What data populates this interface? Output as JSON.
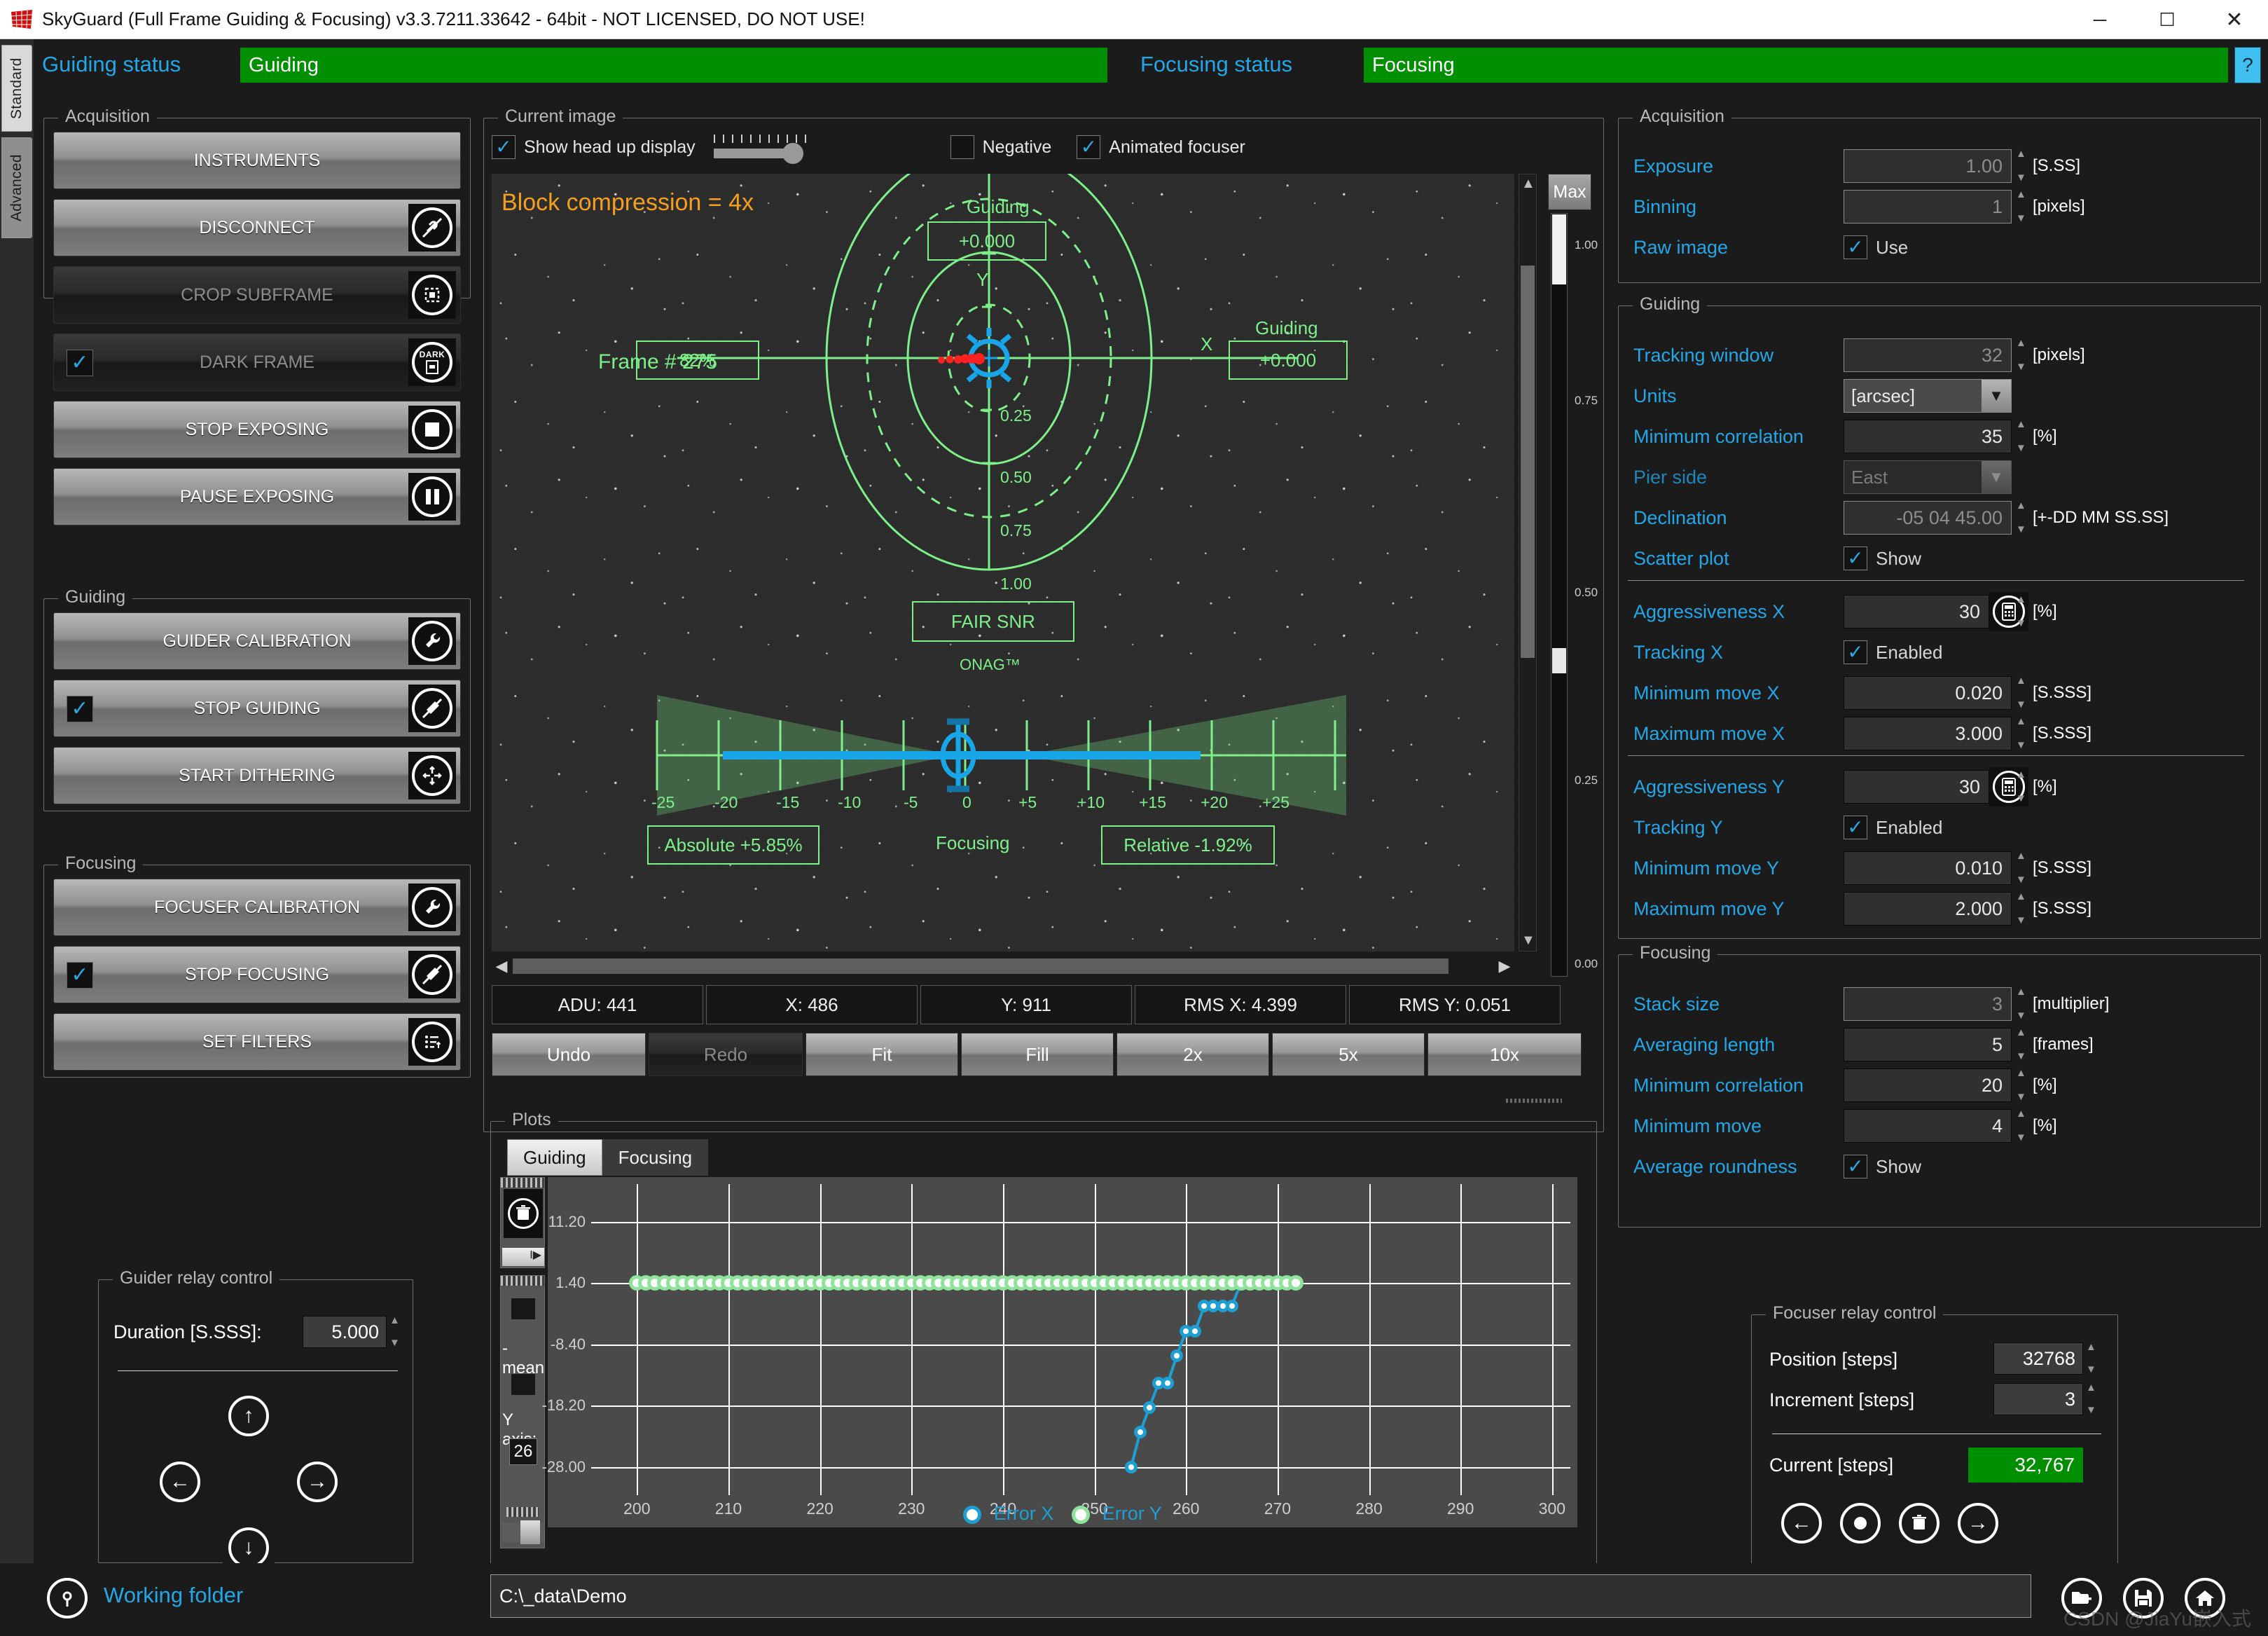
{
  "window": {
    "title": "SkyGuard (Full Frame Guiding & Focusing) v3.3.7211.33642 - 64bit - NOT LICENSED, DO NOT USE!",
    "minimize": "─",
    "maximize": "☐",
    "close": "✕"
  },
  "vtabs": [
    {
      "label": "Standard"
    },
    {
      "label": "Advanced"
    }
  ],
  "status": {
    "guiding_label": "Guiding status",
    "guiding_value": "Guiding",
    "focusing_label": "Focusing status",
    "focusing_value": "Focusing",
    "help": "?",
    "green": "#008f00"
  },
  "left": {
    "acquisition": {
      "title": "Acquisition",
      "buttons": [
        {
          "label": "INSTRUMENTS",
          "icon": "none",
          "checked": null,
          "enabled": true
        },
        {
          "label": "DISCONNECT",
          "icon": "disconnect-plug-icon",
          "checked": null,
          "enabled": true
        },
        {
          "label": "CROP SUBFRAME",
          "icon": "crop-frame-icon",
          "checked": null,
          "enabled": false
        },
        {
          "label": "DARK FRAME",
          "icon": "dark-frame-icon",
          "checked": true,
          "enabled": false
        },
        {
          "label": "STOP EXPOSING",
          "icon": "stop-square-icon",
          "checked": null,
          "enabled": true
        },
        {
          "label": "PAUSE EXPOSING",
          "icon": "pause-icon",
          "checked": null,
          "enabled": true
        }
      ]
    },
    "guiding": {
      "title": "Guiding",
      "buttons": [
        {
          "label": "GUIDER CALIBRATION",
          "icon": "wrench-icon",
          "checked": null,
          "enabled": true
        },
        {
          "label": "STOP GUIDING",
          "icon": "stop-guiding-icon",
          "checked": true,
          "enabled": true
        },
        {
          "label": "START DITHERING",
          "icon": "dither-arrows-icon",
          "checked": null,
          "enabled": true
        }
      ]
    },
    "focusing": {
      "title": "Focusing",
      "buttons": [
        {
          "label": "FOCUSER CALIBRATION",
          "icon": "wrench-icon",
          "checked": null,
          "enabled": true
        },
        {
          "label": "STOP FOCUSING",
          "icon": "stop-focusing-icon",
          "checked": true,
          "enabled": true
        },
        {
          "label": "SET FILTERS",
          "icon": "filter-list-icon",
          "checked": null,
          "enabled": true
        }
      ]
    },
    "guider_relay": {
      "title": "Guider relay control",
      "duration_label": "Duration [S.SSS]:",
      "duration_value": "5.000",
      "up": "↑",
      "down": "↓",
      "left": "←",
      "right": "→"
    }
  },
  "center": {
    "group_title": "Current image",
    "show_hud_label": "Show head up display",
    "show_hud_checked": true,
    "negative_label": "Negative",
    "negative_checked": false,
    "animated_focuser_label": "Animated focuser",
    "animated_focuser_checked": true,
    "hud": {
      "block_compression": "Block compression = 4x",
      "frame": "Frame # 275",
      "guiding_top_label": "Guiding",
      "guiding_top_value": "+0.000",
      "guiding_right_label": "Guiding",
      "guiding_right_value": "+0.000",
      "snr_percent": "82%",
      "snr_quality": "FAIR SNR",
      "axis_y": "Y",
      "axis_x": "X",
      "ring_labels": [
        "0.25",
        "0.50",
        "0.75",
        "1.00"
      ],
      "onag": "ONAG™",
      "focus_scale": [
        "-25",
        "-20",
        "-15",
        "-10",
        "-5",
        "0",
        "+5",
        "+10",
        "+15",
        "+20",
        "+25"
      ],
      "absolute": "Absolute +5.85%",
      "focusing_label": "Focusing",
      "relative": "Relative -1.92%"
    },
    "max_label": "Max",
    "max_ticks": [
      "1.00",
      "0.75",
      "0.50",
      "0.25",
      "0.00"
    ],
    "readouts": [
      {
        "label": "ADU: 441"
      },
      {
        "label": "X: 486"
      },
      {
        "label": "Y: 911"
      },
      {
        "label": "RMS X: 4.399"
      },
      {
        "label": "RMS Y: 0.051"
      }
    ],
    "zoom_buttons": [
      {
        "label": "Undo",
        "enabled": true
      },
      {
        "label": "Redo",
        "enabled": false
      },
      {
        "label": "Fit",
        "enabled": true
      },
      {
        "label": "Fill",
        "enabled": true
      },
      {
        "label": "2x",
        "enabled": true
      },
      {
        "label": "5x",
        "enabled": true
      },
      {
        "label": "10x",
        "enabled": true
      }
    ]
  },
  "plots": {
    "group_title": "Plots",
    "tabs": [
      {
        "label": "Guiding",
        "active": true
      },
      {
        "label": "Focusing",
        "active": false
      }
    ],
    "trash_icon": "trash-icon",
    "mean_label": "-mean",
    "yaxis_label": "Y axis:",
    "yaxis_value": "26"
  },
  "chart_data": {
    "type": "line",
    "title": "",
    "xlabel": "",
    "ylabel": "",
    "grid": true,
    "legend_position": "bottom",
    "xlim": [
      195,
      302
    ],
    "ylim": [
      -32.5,
      17.2
    ],
    "xticks": [
      200,
      210,
      220,
      230,
      240,
      250,
      260,
      270,
      280,
      290,
      300
    ],
    "yticks": [
      11.2,
      1.4,
      -8.4,
      -18.2,
      -28.0
    ],
    "ytick_labels": [
      "11.20",
      "1.40",
      "-8.40",
      "-18.20",
      "-28.00"
    ],
    "series": [
      {
        "name": "Error X",
        "color": "#1e9fd4",
        "x": [
          254,
          255,
          256,
          257,
          258,
          259,
          260,
          261,
          262,
          263,
          264,
          265,
          266,
          267,
          268,
          269,
          270,
          271,
          272
        ],
        "y": [
          -28.0,
          -22.4,
          -18.5,
          -14.6,
          -14.6,
          -10.2,
          -6.3,
          -6.3,
          -2.3,
          -2.3,
          -2.3,
          -2.3,
          1.4,
          1.4,
          1.4,
          1.4,
          1.4,
          1.4,
          1.4
        ]
      },
      {
        "name": "Error Y",
        "color": "#8fe39a",
        "x": [
          200,
          201,
          202,
          203,
          204,
          205,
          206,
          207,
          208,
          209,
          210,
          211,
          212,
          213,
          214,
          215,
          216,
          217,
          218,
          219,
          220,
          221,
          222,
          223,
          224,
          225,
          226,
          227,
          228,
          229,
          230,
          231,
          232,
          233,
          234,
          235,
          236,
          237,
          238,
          239,
          240,
          241,
          242,
          243,
          244,
          245,
          246,
          247,
          248,
          249,
          250,
          251,
          252,
          253,
          254,
          255,
          256,
          257,
          258,
          259,
          260,
          261,
          262,
          263,
          264,
          265,
          266,
          267,
          268,
          269,
          270,
          271,
          272
        ],
        "y": [
          1.4,
          1.4,
          1.4,
          1.4,
          1.4,
          1.4,
          1.4,
          1.4,
          1.4,
          1.4,
          1.4,
          1.4,
          1.4,
          1.4,
          1.4,
          1.4,
          1.4,
          1.4,
          1.4,
          1.4,
          1.4,
          1.4,
          1.4,
          1.4,
          1.4,
          1.4,
          1.4,
          1.4,
          1.4,
          1.4,
          1.4,
          1.4,
          1.4,
          1.4,
          1.4,
          1.4,
          1.4,
          1.4,
          1.4,
          1.4,
          1.4,
          1.4,
          1.4,
          1.4,
          1.4,
          1.4,
          1.4,
          1.4,
          1.4,
          1.4,
          1.4,
          1.4,
          1.4,
          1.4,
          1.4,
          1.4,
          1.4,
          1.4,
          1.4,
          1.4,
          1.4,
          1.4,
          1.4,
          1.4,
          1.4,
          1.4,
          1.4,
          1.4,
          1.4,
          1.4,
          1.4,
          1.4,
          1.4
        ]
      }
    ],
    "legend": [
      {
        "label": "Error X",
        "color": "#1e9fd4"
      },
      {
        "label": "Error Y",
        "color": "#8fe39a"
      }
    ]
  },
  "right": {
    "acquisition": {
      "title": "Acquisition",
      "rows": [
        {
          "label": "Exposure",
          "value": "1.00",
          "unit": "[S.SS]",
          "kind": "spin",
          "readonly": true
        },
        {
          "label": "Binning",
          "value": "1",
          "unit": "[pixels]",
          "kind": "spin",
          "readonly": true
        },
        {
          "label": "Raw image",
          "value": "Use",
          "unit": "",
          "kind": "check",
          "checked": true
        }
      ]
    },
    "guiding": {
      "title": "Guiding",
      "rows": [
        {
          "label": "Tracking window",
          "value": "32",
          "unit": "[pixels]",
          "kind": "spin",
          "readonly": true
        },
        {
          "label": "Units",
          "value": "[arcsec]",
          "unit": "",
          "kind": "select",
          "disabled": false
        },
        {
          "label": "Minimum correlation",
          "value": "35",
          "unit": "[%]",
          "kind": "spin",
          "readonly": false
        },
        {
          "label": "Pier side",
          "value": "East",
          "unit": "",
          "kind": "select",
          "disabled": true
        },
        {
          "label": "Declination",
          "value": "-05 04 45.00",
          "unit": "[+-DD MM SS.SS]",
          "kind": "spin",
          "readonly": true
        },
        {
          "label": "Scatter plot",
          "value": "Show",
          "unit": "",
          "kind": "check",
          "checked": true
        },
        {
          "label": "Aggressiveness X",
          "value": "30",
          "unit": "[%]",
          "kind": "calc",
          "readonly": false
        },
        {
          "label": "Tracking X",
          "value": "Enabled",
          "unit": "",
          "kind": "check",
          "checked": true
        },
        {
          "label": "Minimum move X",
          "value": "0.020",
          "unit": "[S.SSS]",
          "kind": "spin",
          "readonly": false
        },
        {
          "label": "Maximum move X",
          "value": "3.000",
          "unit": "[S.SSS]",
          "kind": "spin",
          "readonly": false
        },
        {
          "label": "Aggressiveness Y",
          "value": "30",
          "unit": "[%]",
          "kind": "calc",
          "readonly": false
        },
        {
          "label": "Tracking Y",
          "value": "Enabled",
          "unit": "",
          "kind": "check",
          "checked": true
        },
        {
          "label": "Minimum move Y",
          "value": "0.010",
          "unit": "[S.SSS]",
          "kind": "spin",
          "readonly": false
        },
        {
          "label": "Maximum move Y",
          "value": "2.000",
          "unit": "[S.SSS]",
          "kind": "spin",
          "readonly": false
        }
      ]
    },
    "focusing": {
      "title": "Focusing",
      "rows": [
        {
          "label": "Stack size",
          "value": "3",
          "unit": "[multiplier]",
          "kind": "spin",
          "readonly": true
        },
        {
          "label": "Averaging length",
          "value": "5",
          "unit": "[frames]",
          "kind": "spin",
          "readonly": false
        },
        {
          "label": "Minimum correlation",
          "value": "20",
          "unit": "[%]",
          "kind": "spin",
          "readonly": false
        },
        {
          "label": "Minimum move",
          "value": "4",
          "unit": "[%]",
          "kind": "spin",
          "readonly": false
        },
        {
          "label": "Average roundness",
          "value": "Show",
          "unit": "",
          "kind": "check",
          "checked": true
        }
      ]
    },
    "focuser_relay": {
      "title": "Focuser relay control",
      "position_label": "Position [steps]",
      "position_value": "32768",
      "increment_label": "Increment [steps]",
      "increment_value": "3",
      "current_label": "Current [steps]",
      "current_value": "32,767",
      "buttons": [
        "left-arrow-icon",
        "target-icon",
        "trash-icon",
        "right-arrow-icon"
      ]
    }
  },
  "bottom": {
    "working_folder_label": "Working folder",
    "path": "C:\\_data\\Demo",
    "corner_buttons": [
      "new-folder-icon",
      "save-icon",
      "home-icon"
    ],
    "watermark": "CSDN @JiaYu嵌入式"
  }
}
